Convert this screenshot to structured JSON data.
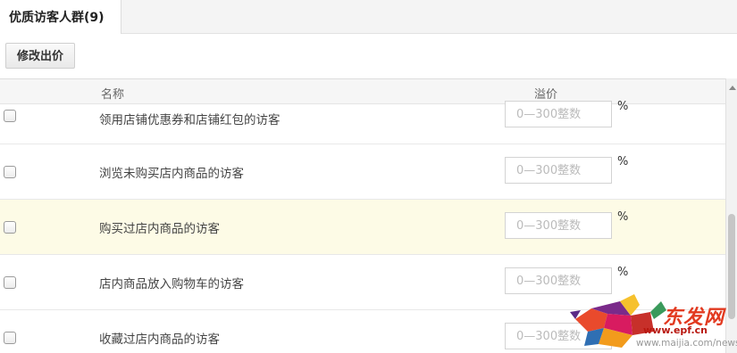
{
  "tabs": [
    {
      "label": "优质访客人群(9)"
    }
  ],
  "toolbar": {
    "edit_label": "修改出价"
  },
  "table": {
    "columns": {
      "name": "名称",
      "premium": "溢价"
    },
    "rows": [
      {
        "name": "领用店铺优惠券和店铺红包的访客",
        "placeholder": "0—300整数",
        "unit": "%"
      },
      {
        "name": "浏览未购买店内商品的访客",
        "placeholder": "0—300整数",
        "unit": "%"
      },
      {
        "name": "购买过店内商品的访客",
        "placeholder": "0—300整数",
        "unit": "%"
      },
      {
        "name": "店内商品放入购物车的访客",
        "placeholder": "0—300整数",
        "unit": "%"
      },
      {
        "name": "收藏过店内商品的访客",
        "placeholder": "0—300整数",
        "unit": "%"
      }
    ]
  },
  "watermark": {
    "site": "东发网",
    "url_main": "www.epf.cn",
    "url_sub": "www.maijia.com/news"
  }
}
